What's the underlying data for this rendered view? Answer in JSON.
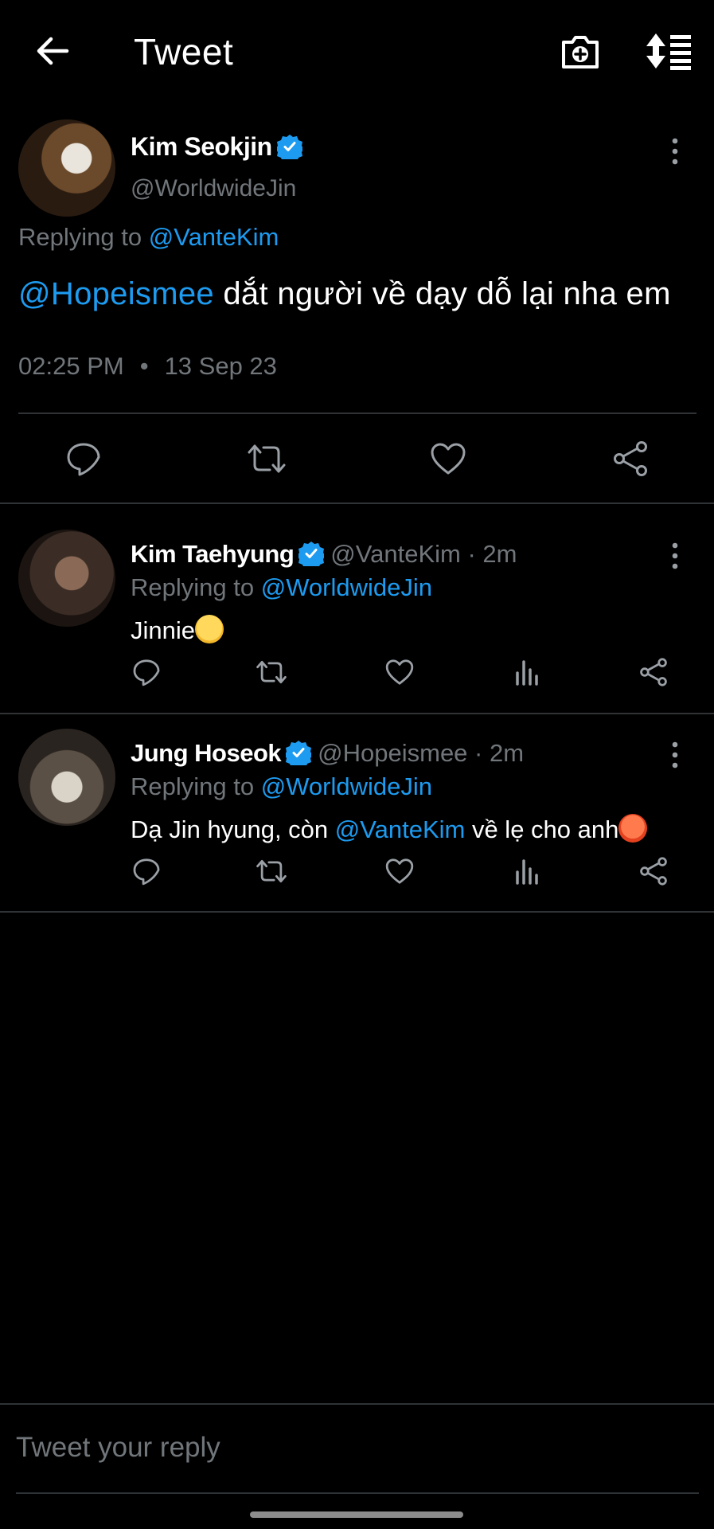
{
  "header": {
    "title": "Tweet",
    "back_icon": "arrow-left-icon",
    "camera_icon": "camera-add-icon",
    "sort_icon": "sort-icon"
  },
  "main_tweet": {
    "name": "Kim Seokjin",
    "handle": "@WorldwideJin",
    "replying_prefix": "Replying to",
    "replying_to": "@VanteKim",
    "mention": "@Hopeismee",
    "text": " dắt người về dạy dỗ lại nha em",
    "time": "02:25 PM",
    "separator": "•",
    "date": "13 Sep 23"
  },
  "replies": [
    {
      "name": "Kim Taehyung",
      "handle": "@VanteKim · 2m",
      "replying_prefix": "Replying to",
      "replying_to": "@WorldwideJin",
      "text": "Jinnie"
    },
    {
      "name": "Jung Hoseok",
      "handle": "@Hopeismee · 2m",
      "replying_prefix": "Replying to",
      "replying_to": "@WorldwideJin",
      "text_before": "Dạ Jin hyung, còn ",
      "mention": "@VanteKim",
      "text_after": " về lẹ cho anh"
    }
  ],
  "reply_box": {
    "placeholder": "Tweet your reply"
  },
  "colors": {
    "background": "#000000",
    "accent": "#1d9bf0",
    "muted": "#71767b",
    "divider": "#2f3336"
  }
}
